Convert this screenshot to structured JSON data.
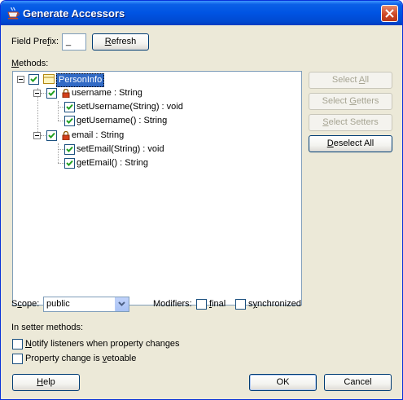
{
  "window": {
    "title": "Generate Accessors"
  },
  "field_prefix": {
    "label_pre": "Field Pre",
    "label_u": "f",
    "label_post": "ix:",
    "value": "_"
  },
  "refresh_button": {
    "pre": "",
    "u": "R",
    "post": "efresh"
  },
  "methods": {
    "label_u": "M",
    "label_post": "ethods:"
  },
  "tree": {
    "root": {
      "label": "PersonInfo",
      "checked": true
    },
    "fields": [
      {
        "label": "username : String",
        "checked": true,
        "methods": [
          {
            "label": "setUsername(String) : void",
            "checked": true
          },
          {
            "label": "getUsername() : String",
            "checked": true
          }
        ]
      },
      {
        "label": "email : String",
        "checked": true,
        "methods": [
          {
            "label": "setEmail(String) : void",
            "checked": true
          },
          {
            "label": "getEmail() : String",
            "checked": true
          }
        ]
      }
    ]
  },
  "side_buttons": {
    "select_all": {
      "pre": "Select ",
      "u": "A",
      "post": "ll",
      "enabled": false
    },
    "select_getters": {
      "pre": "Select ",
      "u": "G",
      "post": "etters",
      "enabled": false
    },
    "select_setters": {
      "pre": "",
      "u": "S",
      "post": "elect Setters",
      "enabled": false
    },
    "deselect_all": {
      "pre": "",
      "u": "D",
      "post": "eselect All",
      "enabled": true
    }
  },
  "scope": {
    "label_pre": "S",
    "label_u": "c",
    "label_post": "ope:",
    "value": "public"
  },
  "modifiers": {
    "label": "Modifiers:",
    "final": {
      "pre": "",
      "u": "f",
      "post": "inal",
      "checked": false
    },
    "synchronized": {
      "pre": "s",
      "u": "y",
      "post": "nchronized",
      "checked": false
    }
  },
  "setter_section": {
    "title": "In setter methods:",
    "notify": {
      "pre": "",
      "u": "N",
      "post": "otify listeners when property changes",
      "checked": false
    },
    "vetoable": {
      "pre": "Property change is ",
      "u": "v",
      "post": "etoable",
      "checked": false
    }
  },
  "footer": {
    "help": {
      "pre": "",
      "u": "H",
      "post": "elp"
    },
    "ok": {
      "label": "OK"
    },
    "cancel": {
      "label": "Cancel"
    }
  },
  "colors": {
    "titlebar": "#0054e3",
    "selection": "#316ac5",
    "dialog_bg": "#ece9d8"
  }
}
